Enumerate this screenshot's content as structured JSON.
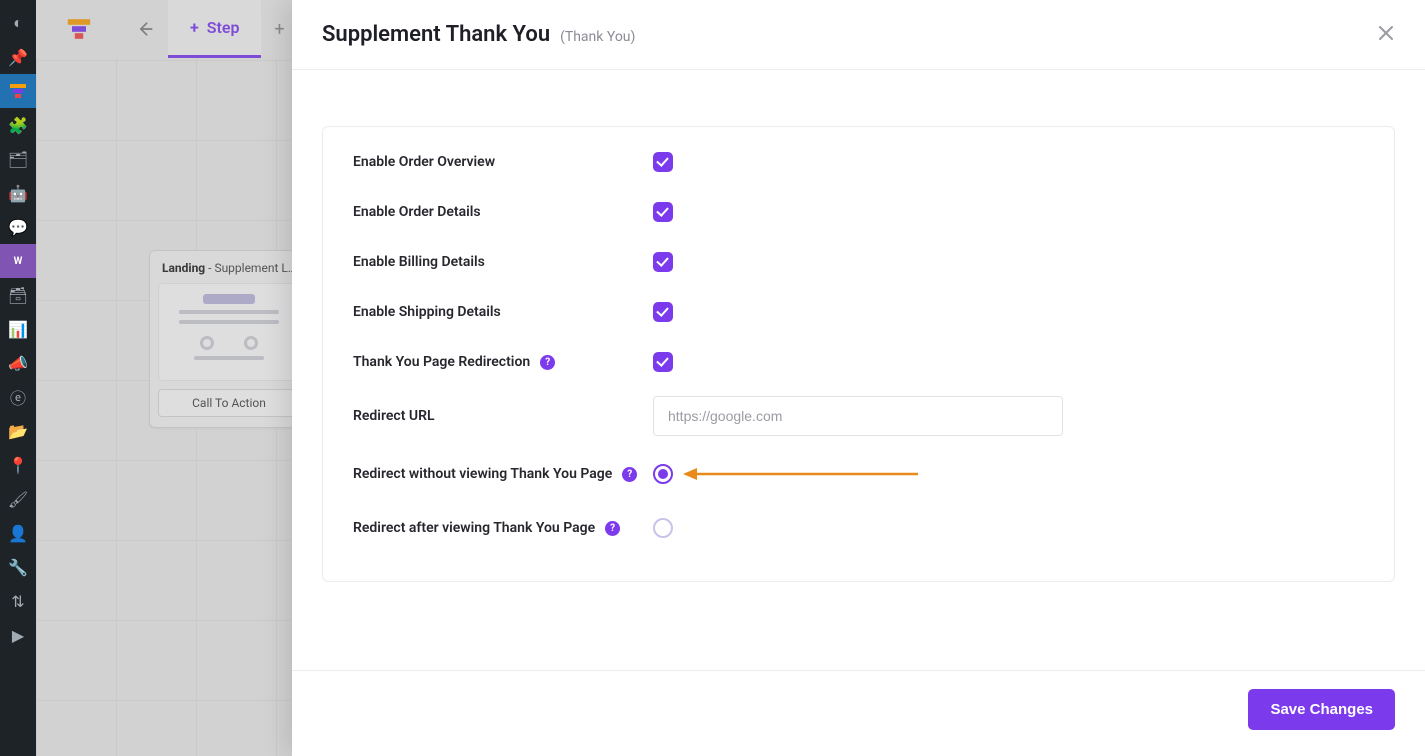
{
  "sidebar": {
    "icons": [
      {
        "name": "dashboard-icon",
        "glyph": "◐"
      },
      {
        "name": "pin-icon",
        "glyph": "📌"
      },
      {
        "name": "funnel-icon",
        "glyph": ""
      },
      {
        "name": "plugin-icon",
        "glyph": "🧩"
      },
      {
        "name": "library-icon",
        "glyph": "🗂"
      },
      {
        "name": "robot-icon",
        "glyph": "🤖"
      },
      {
        "name": "comment-icon",
        "glyph": "💬"
      },
      {
        "name": "woo-icon",
        "glyph": "W"
      },
      {
        "name": "archive-icon",
        "glyph": "🗃"
      },
      {
        "name": "stats-icon",
        "glyph": "📊"
      },
      {
        "name": "megaphone-icon",
        "glyph": "📣"
      },
      {
        "name": "elementor-icon",
        "glyph": "ⓔ"
      },
      {
        "name": "folder-icon",
        "glyph": "📂"
      },
      {
        "name": "pin2-icon",
        "glyph": "📍"
      },
      {
        "name": "brush-icon",
        "glyph": "🖌"
      },
      {
        "name": "user-icon",
        "glyph": "👤"
      },
      {
        "name": "wrench-icon",
        "glyph": "🔧"
      },
      {
        "name": "export-icon",
        "glyph": "⇅"
      },
      {
        "name": "play-icon",
        "glyph": "▶"
      }
    ]
  },
  "topbar": {
    "step_label": "Step"
  },
  "canvas": {
    "node": {
      "type": "Landing",
      "name_trunc": "Supplement La…",
      "cta_label": "Call To Action"
    }
  },
  "panel": {
    "title": "Supplement Thank You",
    "subtitle": "(Thank You)",
    "rows": {
      "enable_order_overview": "Enable Order Overview",
      "enable_order_details": "Enable Order Details",
      "enable_billing_details": "Enable Billing Details",
      "enable_shipping_details": "Enable Shipping Details",
      "thank_you_redirection": "Thank You Page Redirection",
      "redirect_url": "Redirect URL",
      "redirect_without_view": "Redirect without viewing Thank You Page",
      "redirect_after_view": "Redirect after viewing Thank You Page"
    },
    "redirect_url_placeholder": "https://google.com",
    "save_label": "Save Changes",
    "help_glyph": "?"
  }
}
